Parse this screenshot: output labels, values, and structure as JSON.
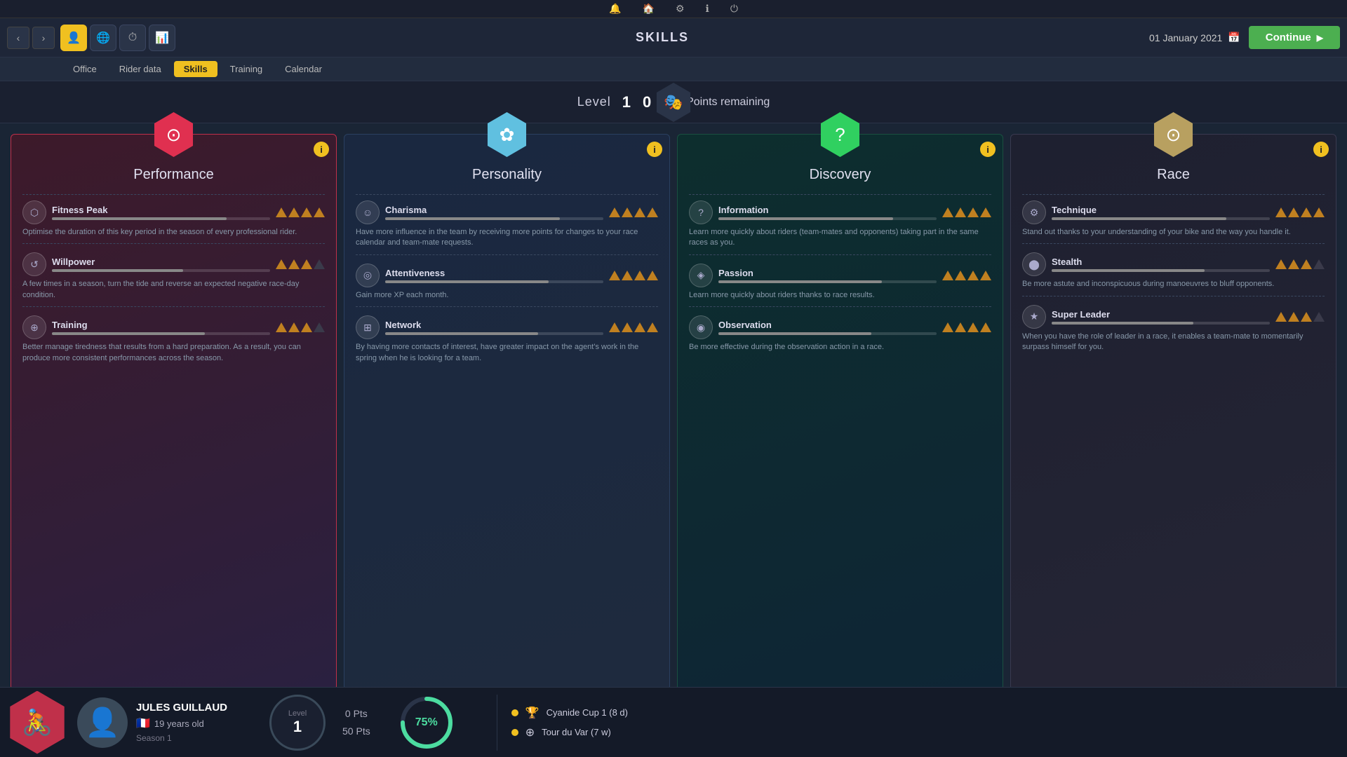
{
  "topnav": {
    "icons": [
      "🔔",
      "🏠",
      "⚙",
      "ℹ",
      "⏻"
    ]
  },
  "secondnav": {
    "title": "SKILLS",
    "date": "01 January 2021",
    "continue_label": "Continue",
    "nav_icons": [
      {
        "id": "rider-icon",
        "symbol": "👤",
        "active": true
      },
      {
        "id": "globe-icon",
        "symbol": "🌐",
        "active": false
      },
      {
        "id": "clock-icon",
        "symbol": "⏱",
        "active": false
      },
      {
        "id": "chart-icon",
        "symbol": "📊",
        "active": false
      }
    ]
  },
  "subtabs": {
    "tabs": [
      "Office",
      "Rider data",
      "Skills",
      "Training",
      "Calendar"
    ],
    "active": "Skills"
  },
  "levelbar": {
    "level_label": "Level",
    "level_value": "1",
    "skill_points_value": "0",
    "skill_points_label": "Skill Points remaining"
  },
  "cards": [
    {
      "id": "performance",
      "title": "Performance",
      "icon": "⊙",
      "hex_class": "hex-performance",
      "card_class": "performance",
      "skills": [
        {
          "name": "Fitness Peak",
          "icon": "⬡",
          "bar_fill": 80,
          "triangles": [
            true,
            true,
            true,
            true
          ],
          "desc": "Optimise the duration of this key period in the season of every professional rider."
        },
        {
          "name": "Willpower",
          "icon": "↺",
          "bar_fill": 60,
          "triangles": [
            true,
            true,
            true,
            false
          ],
          "desc": "A few times in a season, turn the tide and reverse an expected negative race-day condition."
        },
        {
          "name": "Training",
          "icon": "⊕",
          "bar_fill": 70,
          "triangles": [
            true,
            true,
            true,
            false
          ],
          "desc": "Better manage tiredness that results from a hard preparation. As a result, you can produce more consistent performances across the season."
        }
      ]
    },
    {
      "id": "personality",
      "title": "Personality",
      "icon": "✿",
      "hex_class": "hex-personality",
      "card_class": "personality",
      "skills": [
        {
          "name": "Charisma",
          "icon": "☺",
          "bar_fill": 80,
          "triangles": [
            true,
            true,
            true,
            true
          ],
          "desc": "Have more influence in the team by receiving more points for changes to your race calendar and team-mate requests."
        },
        {
          "name": "Attentiveness",
          "icon": "◎",
          "bar_fill": 75,
          "triangles": [
            true,
            true,
            true,
            true
          ],
          "desc": "Gain more XP each month."
        },
        {
          "name": "Network",
          "icon": "⊞",
          "bar_fill": 70,
          "triangles": [
            true,
            true,
            true,
            true
          ],
          "desc": "By having more contacts of interest, have greater impact on the agent's work in the spring when he is looking for a team."
        }
      ]
    },
    {
      "id": "discovery",
      "title": "Discovery",
      "icon": "?",
      "hex_class": "hex-discovery",
      "card_class": "discovery",
      "skills": [
        {
          "name": "Information",
          "icon": "?",
          "bar_fill": 80,
          "triangles": [
            true,
            true,
            true,
            true
          ],
          "desc": "Learn more quickly about riders (team-mates and opponents) taking part in the same races as you."
        },
        {
          "name": "Passion",
          "icon": "◈",
          "bar_fill": 75,
          "triangles": [
            true,
            true,
            true,
            true
          ],
          "desc": "Learn more quickly about riders thanks to race results."
        },
        {
          "name": "Observation",
          "icon": "◉",
          "bar_fill": 70,
          "triangles": [
            true,
            true,
            true,
            true
          ],
          "desc": "Be more effective during the observation action in a race."
        }
      ]
    },
    {
      "id": "race",
      "title": "Race",
      "icon": "⊙",
      "hex_class": "hex-race",
      "card_class": "race",
      "skills": [
        {
          "name": "Technique",
          "icon": "⚙",
          "bar_fill": 80,
          "triangles": [
            true,
            true,
            true,
            true
          ],
          "desc": "Stand out thanks to your understanding of your bike and the way you handle it."
        },
        {
          "name": "Stealth",
          "icon": "⬤",
          "bar_fill": 70,
          "triangles": [
            true,
            true,
            true,
            false
          ],
          "desc": "Be more astute and inconspicuous during manoeuvres to bluff opponents."
        },
        {
          "name": "Super Leader",
          "icon": "★",
          "bar_fill": 65,
          "triangles": [
            true,
            true,
            true,
            false
          ],
          "desc": "When you have the role of leader in a race, it enables a team-mate to momentarily surpass himself for you."
        }
      ]
    }
  ],
  "bottombar": {
    "rider_name": "JULES GUILLAUD",
    "rider_age": "19 years old",
    "rider_flag": "🇫🇷",
    "rider_season": "Season 1",
    "level_label": "Level",
    "level_value": "1",
    "pts_current": "0 Pts",
    "pts_total": "50 Pts",
    "progress_pct": "75%",
    "races": [
      {
        "icon": "🏆",
        "name": "Cyanide Cup 1 (8 d)"
      },
      {
        "icon": "⊕",
        "name": "Tour du Var (7 w)"
      }
    ]
  }
}
